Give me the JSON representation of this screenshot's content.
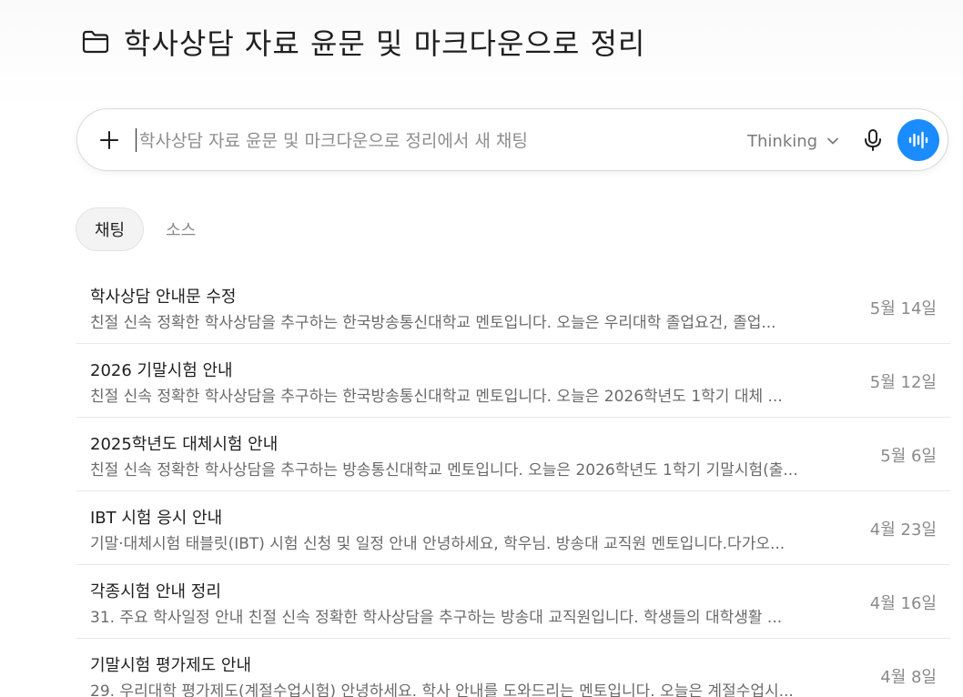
{
  "header": {
    "title": "학사상담 자료 윤문 및 마크다운으로 정리"
  },
  "composer": {
    "placeholder": "학사상담 자료 윤문 및 마크다운으로 정리에서 새 채팅",
    "value": "",
    "model_label": "Thinking"
  },
  "tabs": [
    {
      "label": "채팅",
      "active": true
    },
    {
      "label": "소스",
      "active": false
    }
  ],
  "chats": [
    {
      "title": "학사상담 안내문 수정",
      "snippet": "친절 신속 정확한 학사상담을 추구하는 한국방송통신대학교 멘토입니다. 오늘은 우리대학 졸업요건, 졸업...",
      "date": "5월 14일"
    },
    {
      "title": "2026 기말시험 안내",
      "snippet": "친절 신속 정확한 학사상담을 추구하는 한국방송통신대학교 멘토입니다. 오늘은 2026학년도 1학기 대체 ...",
      "date": "5월 12일"
    },
    {
      "title": "2025학년도 대체시험 안내",
      "snippet": "친절 신속 정확한 학사상담을 추구하는 방송통신대학교 멘토입니다. 오늘은 2026학년도 1학기 기말시험(출...",
      "date": "5월 6일"
    },
    {
      "title": "IBT 시험 응시 안내",
      "snippet": "기말·대체시험 태블릿(IBT) 시험 신청 및 일정 안내 안녕하세요, 학우님. 방송대 교직원 멘토입니다.다가오...",
      "date": "4월 23일"
    },
    {
      "title": "각종시험 안내 정리",
      "snippet": "31. 주요 학사일정 안내 친절 신속 정확한 학사상담을 추구하는 방송대 교직원입니다. 학생들의 대학생활 ...",
      "date": "4월 16일"
    },
    {
      "title": "기말시험 평가제도 안내",
      "snippet": "29. 우리대학 평가제도(계절수업시험) 안녕하세요. 학사 안내를 도와드리는 멘토입니다. 오늘은 계절수업시...",
      "date": "4월 8일"
    }
  ]
}
